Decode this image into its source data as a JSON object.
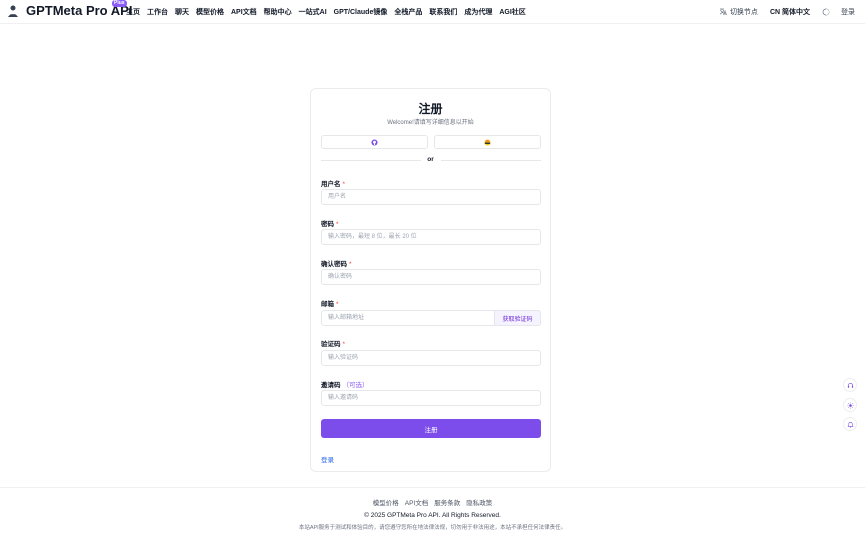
{
  "header": {
    "brand": "GPTMeta Pro API",
    "brand_badge": "Plus",
    "nav": [
      "主页",
      "工作台",
      "聊天",
      "模型价格",
      "API文档",
      "帮助中心",
      "一站式AI",
      "GPT/Claude镜像",
      "全栈产品",
      "联系我们",
      "成为代理",
      "AGI社区"
    ],
    "switch_node": "切换节点",
    "language": "CN 简体中文",
    "login": "登录"
  },
  "form": {
    "title": "注册",
    "subtitle": "Welcome!请填写详细信息以开始",
    "divider": "or",
    "username_label": "用户名",
    "username_placeholder": "用户名",
    "password_label": "密码",
    "password_placeholder": "输入密码，最短 8 位，最长 20 位",
    "confirm_label": "确认密码",
    "confirm_placeholder": "确认密码",
    "email_label": "邮箱",
    "email_placeholder": "输入邮箱地址",
    "get_code": "获取验证码",
    "code_label": "验证码",
    "code_placeholder": "输入验证码",
    "invite_label": "邀请码",
    "invite_optional": "（可选）",
    "invite_placeholder": "输入邀请码",
    "required_mark": "*",
    "submit": "注册",
    "login_link": "登录"
  },
  "footer": {
    "links": [
      "模型价格",
      "API文档",
      "服务条款",
      "隐私政策"
    ],
    "copyright": "© 2025 GPTMeta Pro API. All Rights Reserved.",
    "disclaimer": "本站API服务于测试和体验目的，请您遵守您所在地法律法规，切勿用于非法用途，本站不承担任何法律责任。"
  },
  "colors": {
    "accent": "#7c4dea",
    "link": "#2563eb",
    "required": "#ef4444"
  },
  "icons": [
    "logo-icon",
    "github-icon",
    "oidc-icon",
    "translate-icon",
    "theme-icon",
    "headset-icon",
    "sun-icon",
    "bell-icon"
  ]
}
